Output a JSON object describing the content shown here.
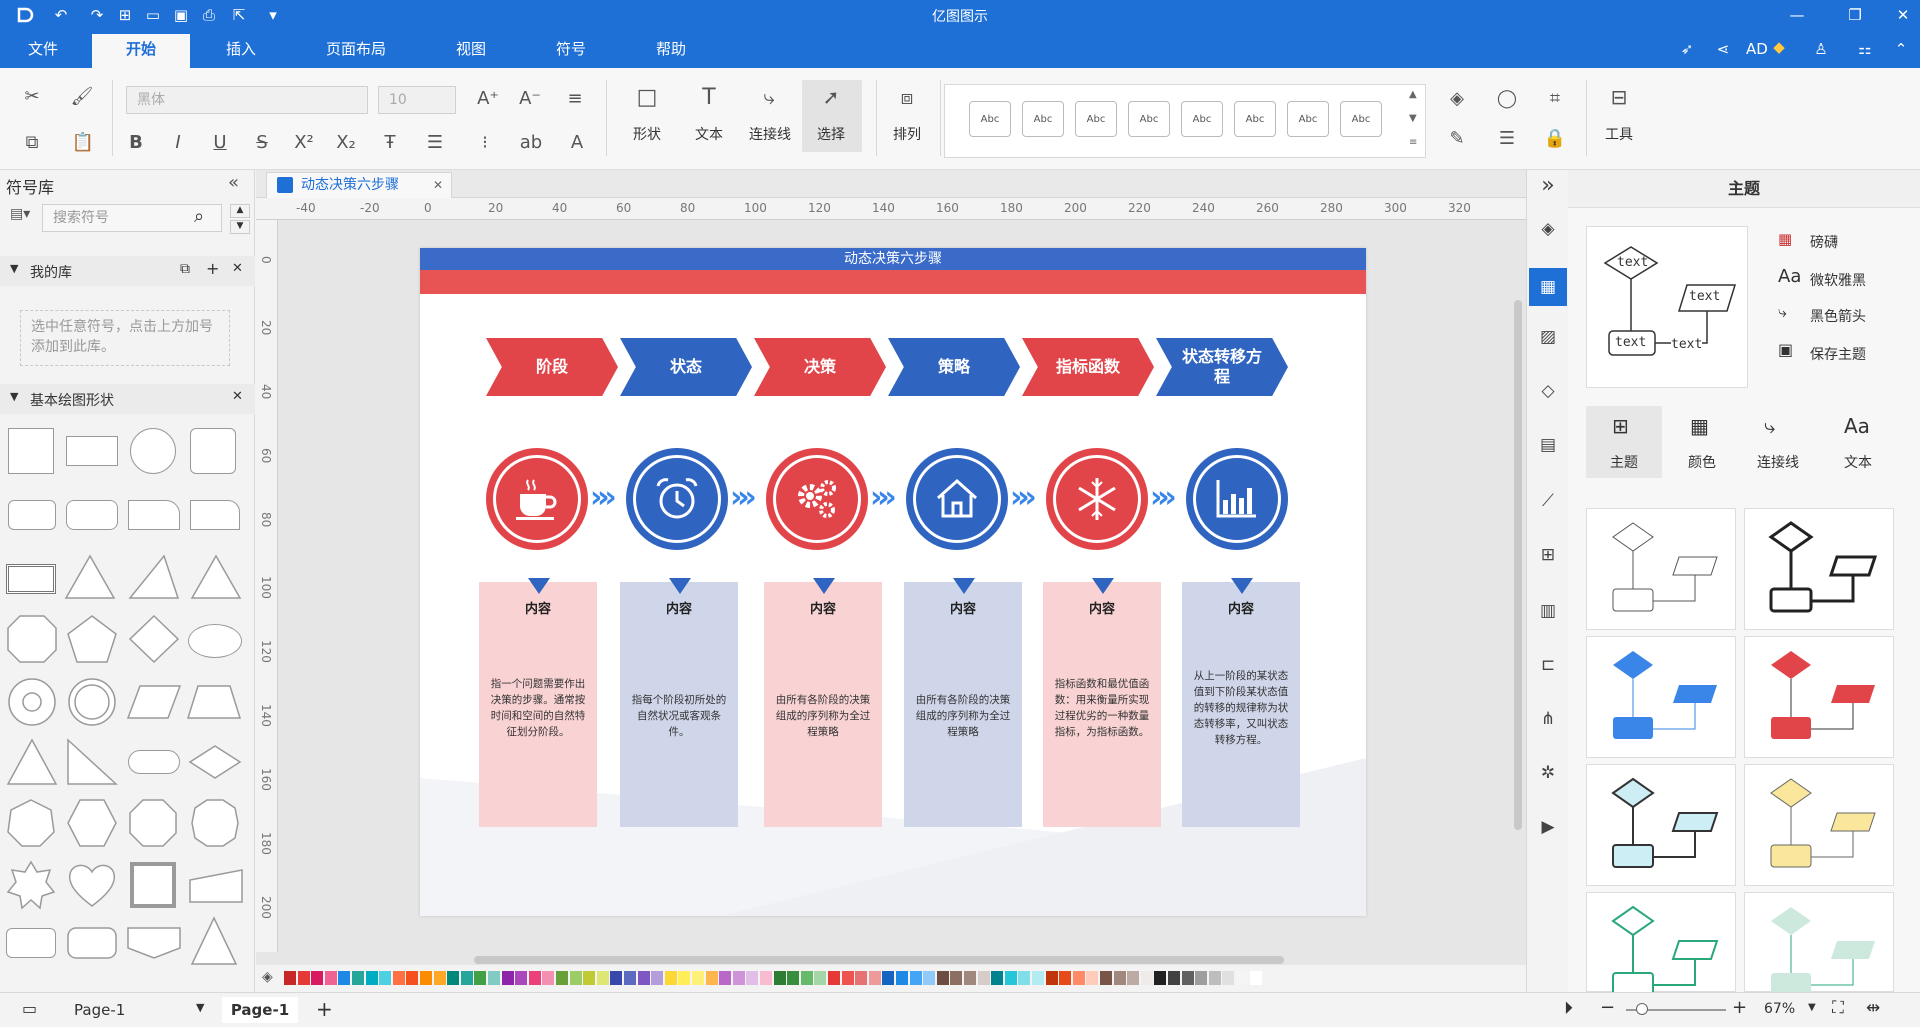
{
  "app": {
    "title": "亿图图示",
    "user": "AD"
  },
  "menu": [
    "文件",
    "开始",
    "插入",
    "页面布局",
    "视图",
    "符号",
    "帮助"
  ],
  "ribbon": {
    "font_name": "黑体",
    "font_size": "10",
    "shape_label": "形状",
    "text_label": "文本",
    "connector_label": "连接线",
    "select_label": "选择",
    "arrange_label": "排列",
    "tools_label": "工具",
    "style_sample": "Abc"
  },
  "left_panel": {
    "title": "符号库",
    "search_placeholder": "搜索符号",
    "my_library": "我的库",
    "my_library_hint": "选中任意符号，点击上方加号添加到此库。",
    "basic_shapes": "基本绘图形状"
  },
  "document": {
    "tab_title": "动态决策六步骤",
    "banner_title": "动态决策六步骤",
    "steps": [
      "阶段",
      "状态",
      "决策",
      "策略",
      "指标函数",
      "状态转移方程"
    ],
    "card_title": "内容",
    "cards": [
      "指一个问题需要作出决策的步骤。通常按时间和空间的自然特征划分阶段。",
      "指每个阶段初所处的自然状况或客观条件。",
      "由所有各阶段的决策组成的序列称为全过程策略",
      "由所有各阶段的决策组成的序列称为全过程策略",
      "指标函数和最优值函数：用来衡量所实现过程优劣的一种数量指标，为指标函数。",
      "从上一阶段的某状态值到下阶段某状态值的转移的规律称为状态转移率，又叫状态转移方程。"
    ]
  },
  "ruler": {
    "h": [
      "-40",
      "-20",
      "0",
      "20",
      "40",
      "60",
      "80",
      "100",
      "120",
      "140",
      "160",
      "180",
      "200",
      "220",
      "240",
      "260",
      "280",
      "300",
      "320"
    ],
    "v": [
      "0",
      "20",
      "40",
      "60",
      "80",
      "100",
      "120",
      "140",
      "160",
      "180",
      "200"
    ]
  },
  "right_panel": {
    "title": "主题",
    "actions": [
      "磅礴",
      "微软雅黑",
      "黑色箭头",
      "保存主题"
    ],
    "preview_text": [
      "text",
      "text",
      "text",
      "text"
    ],
    "tabs": [
      "主题",
      "颜色",
      "连接线",
      "文本"
    ]
  },
  "status": {
    "page_selector": "Page-1",
    "current_page": "Page-1",
    "zoom": "67%"
  },
  "colors": {
    "accent": "#1e6fd6",
    "red": "#e1454a",
    "blue": "#2f64c0",
    "pink_card": "#f9d3d3",
    "blue_card": "#cfd6ea"
  }
}
